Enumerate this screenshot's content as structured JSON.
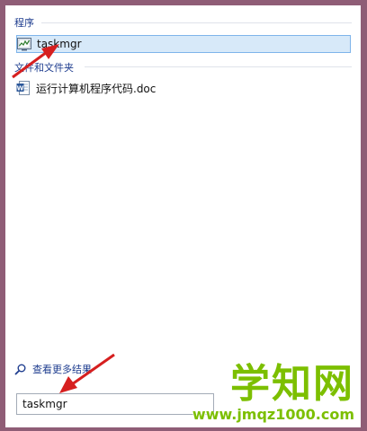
{
  "groups": {
    "programs": {
      "header": "程序",
      "items": [
        {
          "label": "taskmgr",
          "icon": "task-manager-icon",
          "selected": true
        }
      ]
    },
    "files": {
      "header": "文件和文件夹",
      "items": [
        {
          "label": "运行计算机程序代码.doc",
          "icon": "word-document-icon"
        }
      ]
    }
  },
  "see_more": {
    "label": "查看更多结果",
    "icon": "search-icon"
  },
  "search": {
    "value": "taskmgr"
  },
  "watermark": {
    "title": "学知网",
    "url": "www.jmqz1000.com"
  },
  "colors": {
    "frame": "#8f5d76",
    "header_text": "#1e3d8f",
    "selection_bg": "#d7e9f9",
    "selection_border": "#7eb4ea",
    "arrow": "#d61f1f",
    "watermark": "#7cbf00"
  }
}
